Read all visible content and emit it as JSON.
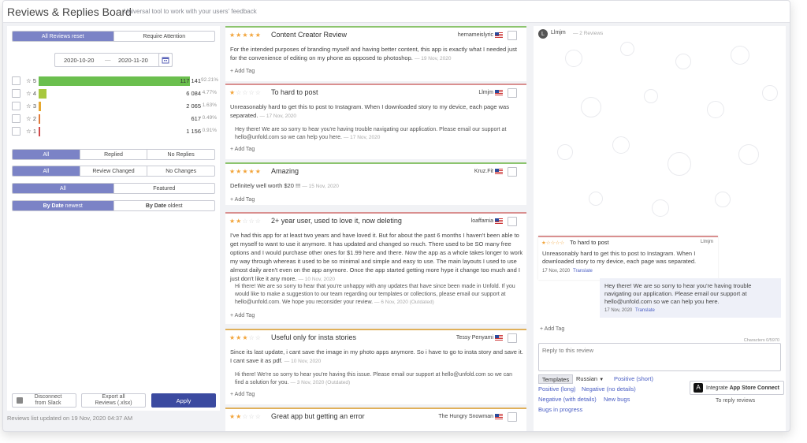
{
  "header": {
    "title": "Reviews & Replies Board",
    "subtitle": "Universal tool to work with your users' feedback"
  },
  "sidebar": {
    "review_filter": {
      "active": "All Reviews",
      "active_suffix": "reset",
      "other": "Require Attention"
    },
    "dates": {
      "from": "2020-10-20",
      "separator": "—",
      "to": "2020-11-20"
    },
    "ratings": [
      {
        "label": "5",
        "count": "117 141",
        "percent": "92.21%",
        "share": 0.9221,
        "color": "#6bbf4e"
      },
      {
        "label": "4",
        "count": "6 084",
        "percent": "4.77%",
        "share": 0.0477,
        "color": "#a8c83f"
      },
      {
        "label": "3",
        "count": "2 065",
        "percent": "1.63%",
        "share": 0.0163,
        "color": "#e6a830"
      },
      {
        "label": "2",
        "count": "617",
        "percent": "0.49%",
        "share": 0.0049,
        "color": "#e07a3a"
      },
      {
        "label": "1",
        "count": "1 156",
        "percent": "0.91%",
        "share": 0.0091,
        "color": "#d0494a"
      }
    ],
    "reply_filter": [
      "All",
      "Replied",
      "No Replies"
    ],
    "change_filter": [
      "All",
      "Review Changed",
      "No Changes"
    ],
    "feature_filter": [
      "All",
      "Featured"
    ],
    "sort": {
      "active_bold": "By Date",
      "active_rest": "newest",
      "other_bold": "By Date",
      "other_rest": "oldest"
    },
    "disconnect": "Disconnect\nfrom Slack",
    "export": "Export all\nReviews (.xlsx)",
    "apply": "Apply",
    "status": "Reviews list updated on 19 Nov, 2020 04:37 AM"
  },
  "reviews": [
    {
      "stars": 5,
      "title": "Content Creator Review",
      "author": "hernameislyric",
      "body": "For the intended purposes of branding myself and having better content, this app is exactly what I needed just for the convenience of editing on my phone as opposed to photoshop.",
      "date": "— 19 Nov, 2020",
      "reply": "",
      "reply_date": "",
      "add_tag": "+ Add Tag"
    },
    {
      "stars": 1,
      "title": "To hard to post",
      "author": "Llmjm",
      "body": "Unreasonably hard to get this to post to Instagram. When I downloaded story to my device, each page was separated.",
      "date": "— 17 Nov, 2020",
      "reply": "Hey there! We are so sorry to hear you're having trouble navigating our application. Please email our support at hello@unfold.com so we can help you here.",
      "reply_date": "— 17 Nov, 2020",
      "add_tag": "+ Add Tag"
    },
    {
      "stars": 5,
      "title": "Amazing",
      "author": "Kruz.Fit",
      "body": "Definitely well worth $20 !!!",
      "date": "— 15 Nov, 2020",
      "reply": "",
      "reply_date": "",
      "add_tag": "+ Add Tag"
    },
    {
      "stars": 2,
      "title": "2+ year user, used to love it, now deleting",
      "author": "loaffamia",
      "body": "I've had this app for at least two years and have loved it. But for about the past 6 months I haven't been able to get myself to want to use it anymore. It has updated and changed so much. There used to be SO many free options and I would purchase other ones for $1.99 here and there. Now the app as a whole takes longer to work my way through whereas it used to be so minimal and simple and easy to use. The main layouts I used to use almost daily aren't even on the app anymore. Once the app started getting more hype it change too much and I just don't like it any more.",
      "date": "— 10 Nov, 2020",
      "reply": "Hi there! We are so sorry to hear that you're unhappy with any updates that have since been made in Unfold. If you would like to make a suggestion to our team regarding our templates or collections, please email our support at hello@unfold.com. We hope you reconsider your review.",
      "reply_date": "— 6 Nov, 2020 (Outdated)",
      "add_tag": "+ Add Tag"
    },
    {
      "stars": 3,
      "title": "Useful only for insta stories",
      "author": "Tessy Penyami",
      "body": "Since its last update, i cant save the image in my photo apps anymore. So i have to go to insta story and save it. I cant save it as pdf.",
      "date": "— 10 Nov, 2020",
      "reply": "Hi there! We're so sorry to hear you're having this issue. Please email our support at hello@unfold.com so we can find a solution for you.",
      "reply_date": "— 3 Nov, 2020 (Outdated)",
      "add_tag": "+ Add Tag"
    },
    {
      "stars": 2,
      "title": "Great app but getting an error",
      "author": "The Hungry Snowman",
      "body": "",
      "date": "",
      "reply": "",
      "reply_date": "",
      "add_tag": ""
    }
  ],
  "panel": {
    "avatar_letter": "L",
    "user": "Llmjm",
    "review_count": "— 2 Reviews",
    "review": {
      "stars": 1,
      "title": "To hard to post",
      "author": "Llmjm",
      "body": "Unreasonably hard to get this to post to Instagram. When I downloaded story to my device, each page was separated.",
      "date": "17 Nov, 2020",
      "translate": "Translate"
    },
    "reply": {
      "body": "Hey there! We are so sorry to hear you're having trouble navigating our application. Please email our support at hello@unfold.com so we can help you here.",
      "date": "17 Nov, 2020",
      "translate": "Translate"
    },
    "add_tag": "+ Add Tag",
    "characters": "Characters 0/5970",
    "reply_placeholder": "Reply to this review",
    "templates": "Templates",
    "language": "Russian",
    "template_links": [
      "Positive (short)",
      "Positive (long)",
      "Negative (no details)",
      "Negative (with details)",
      "New bugs",
      "Bugs in progress"
    ],
    "integrate_prefix": "Integrate",
    "integrate_bold": "App Store Connect",
    "to_reply": "To reply reviews"
  },
  "colors": {
    "accent": "#7b83c6",
    "apply": "#3b4aa0",
    "link": "#4a5ec4",
    "star": "#f2a43a"
  }
}
